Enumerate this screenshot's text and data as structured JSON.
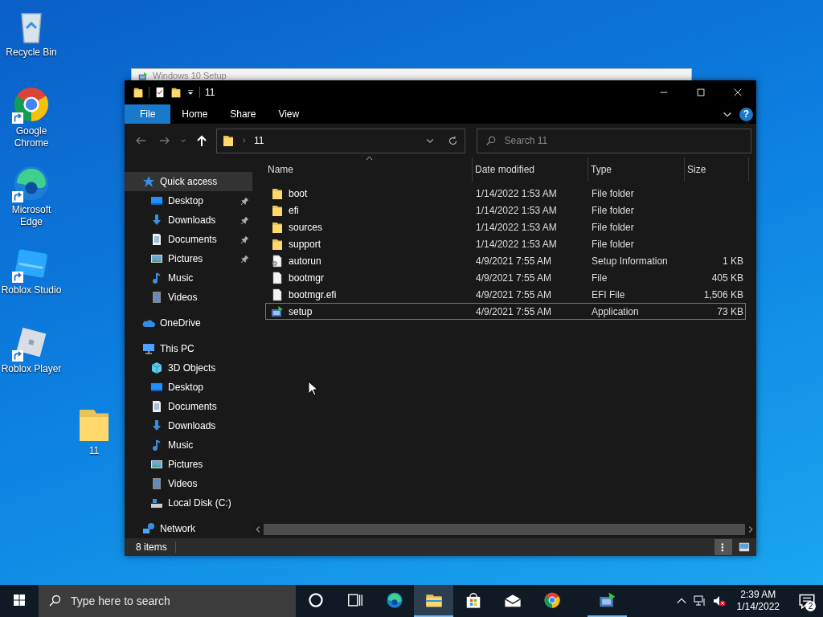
{
  "desktop_icons": [
    {
      "label": "Recycle Bin",
      "kind": "recycle",
      "shortcut": false
    },
    {
      "label": "Google Chrome",
      "kind": "chrome",
      "shortcut": true
    },
    {
      "label": "Microsoft Edge",
      "kind": "edge",
      "shortcut": true
    },
    {
      "label": "Roblox Studio",
      "kind": "studio",
      "shortcut": true
    },
    {
      "label": "Roblox Player",
      "kind": "roblox",
      "shortcut": true
    },
    {
      "label": "11",
      "kind": "folder",
      "shortcut": false
    }
  ],
  "background_window": {
    "title": "Windows 10 Setup"
  },
  "explorer": {
    "title": "11",
    "ribbon_tabs": [
      {
        "label": "File",
        "selected": true
      },
      {
        "label": "Home",
        "selected": false
      },
      {
        "label": "Share",
        "selected": false
      },
      {
        "label": "View",
        "selected": false
      }
    ],
    "help": "?",
    "back_enabled": false,
    "forward_enabled": false,
    "address": "11",
    "search": {
      "placeholder": "Search 11"
    },
    "nav": [
      {
        "label": "Quick access",
        "kind": "star",
        "selected": true,
        "children": [
          {
            "label": "Desktop",
            "kind": "desktop",
            "pinned": true,
            "selected": false
          },
          {
            "label": "Downloads",
            "kind": "download",
            "pinned": true,
            "selected": false
          },
          {
            "label": "Documents",
            "kind": "documents",
            "pinned": true,
            "selected": false
          },
          {
            "label": "Pictures",
            "kind": "pictures",
            "pinned": true,
            "selected": false
          },
          {
            "label": "Music",
            "kind": "music",
            "pinned": false,
            "selected": false
          },
          {
            "label": "Videos",
            "kind": "videos",
            "pinned": false,
            "selected": false
          }
        ]
      },
      {
        "label": "OneDrive",
        "kind": "onedrive",
        "selected": false
      },
      {
        "label": "This PC",
        "kind": "pc",
        "selected": false,
        "children": [
          {
            "label": "3D Objects",
            "kind": "cube",
            "pinned": false,
            "selected": false
          },
          {
            "label": "Desktop",
            "kind": "desktop",
            "pinned": false,
            "selected": false
          },
          {
            "label": "Documents",
            "kind": "documents",
            "pinned": false,
            "selected": false
          },
          {
            "label": "Downloads",
            "kind": "download",
            "pinned": false,
            "selected": false
          },
          {
            "label": "Music",
            "kind": "music",
            "pinned": false,
            "selected": false
          },
          {
            "label": "Pictures",
            "kind": "pictures",
            "pinned": false,
            "selected": false
          },
          {
            "label": "Videos",
            "kind": "videos",
            "pinned": false,
            "selected": false
          },
          {
            "label": "Local Disk (C:)",
            "kind": "disk",
            "pinned": false,
            "selected": false
          }
        ]
      },
      {
        "label": "Network",
        "kind": "network",
        "selected": false
      }
    ],
    "columns": [
      {
        "label": "Name",
        "sorted": true
      },
      {
        "label": "Date modified",
        "sorted": false
      },
      {
        "label": "Type",
        "sorted": false
      },
      {
        "label": "Size",
        "sorted": false
      }
    ],
    "rows": [
      {
        "name": "boot",
        "date": "1/14/2022 1:53 AM",
        "type": "File folder",
        "size": "",
        "kind": "folder",
        "focused": false
      },
      {
        "name": "efi",
        "date": "1/14/2022 1:53 AM",
        "type": "File folder",
        "kind": "folder",
        "focused": false
      },
      {
        "name": "sources",
        "date": "1/14/2022 1:53 AM",
        "type": "File folder",
        "kind": "folder",
        "focused": false
      },
      {
        "name": "support",
        "date": "1/14/2022 1:53 AM",
        "type": "File folder",
        "kind": "folder",
        "focused": false
      },
      {
        "name": "autorun",
        "date": "4/9/2021 7:55 AM",
        "type": "Setup Information",
        "size": "1 KB",
        "kind": "inf",
        "focused": false
      },
      {
        "name": "bootmgr",
        "date": "4/9/2021 7:55 AM",
        "type": "File",
        "size": "405 KB",
        "kind": "file",
        "focused": false
      },
      {
        "name": "bootmgr.efi",
        "date": "4/9/2021 7:55 AM",
        "type": "EFI File",
        "size": "1,506 KB",
        "kind": "file",
        "focused": false
      },
      {
        "name": "setup",
        "date": "4/9/2021 7:55 AM",
        "type": "Application",
        "size": "73 KB",
        "kind": "setup",
        "focused": true
      }
    ],
    "status": "8 items"
  },
  "taskbar": {
    "search_placeholder": "Type here to search",
    "apps": [
      {
        "kind": "cortana",
        "active": false,
        "running": false
      },
      {
        "kind": "taskview",
        "active": false,
        "running": false
      },
      {
        "kind": "edge",
        "active": false,
        "running": false
      },
      {
        "kind": "explorer",
        "active": true,
        "running": true
      },
      {
        "kind": "store",
        "active": false,
        "running": false
      },
      {
        "kind": "mail",
        "active": false,
        "running": false
      },
      {
        "kind": "chrome",
        "active": false,
        "running": false
      },
      {
        "kind": "setup",
        "active": false,
        "running": true
      }
    ],
    "time": "2:39 AM",
    "date": "1/14/2022",
    "notification_count": "2"
  }
}
